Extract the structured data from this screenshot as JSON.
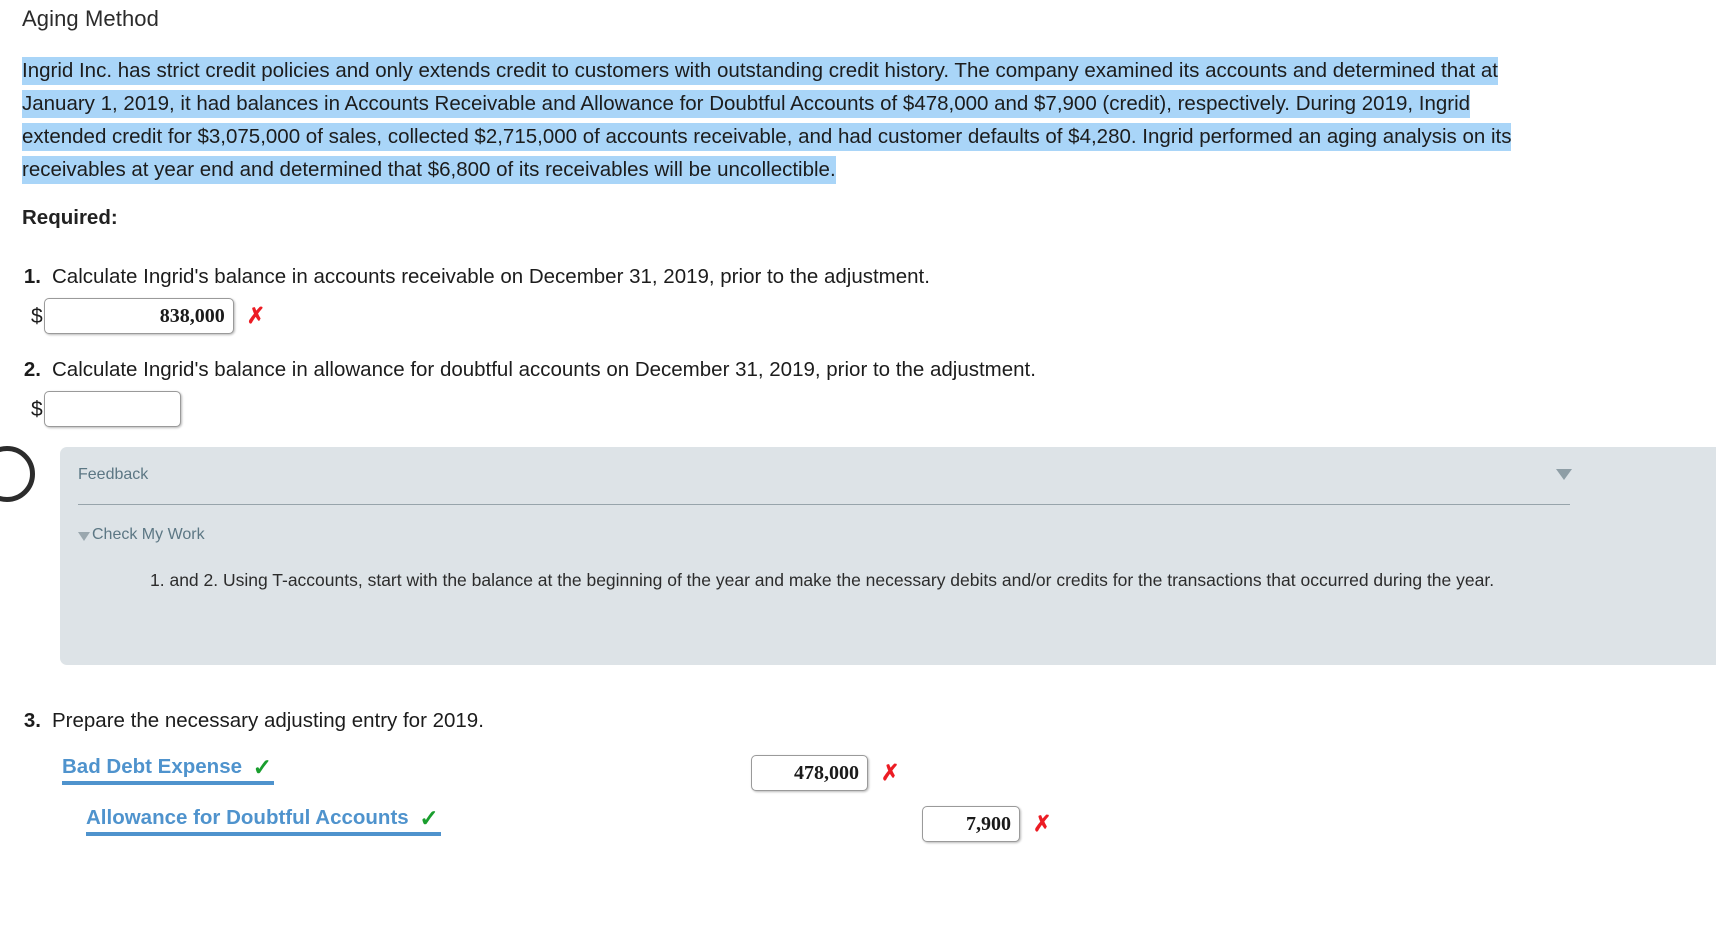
{
  "page": {
    "title": "Aging Method",
    "problem_text": "Ingrid Inc. has strict credit policies and only extends credit to customers with outstanding credit history. The company examined its accounts and determined that at January 1, 2019, it had balances in Accounts Receivable and Allowance for Doubtful Accounts of $478,000 and $7,900 (credit), respectively. During 2019, Ingrid extended credit for $3,075,000 of sales, collected $2,715,000 of accounts receivable, and had customer defaults of $4,280. Ingrid performed an aging analysis on its receivables at year end and determined that $6,800 of its receivables will be uncollectible.",
    "required_label": "Required:",
    "highlight_color": "#a9d5f8"
  },
  "requirements": [
    {
      "number": "1.",
      "text": "Calculate Ingrid's balance in accounts receivable on December 31, 2019, prior to the adjustment.",
      "currency_symbol": "$",
      "value": "838,000",
      "placeholder": "",
      "status": "incorrect",
      "status_glyph": "✗"
    },
    {
      "number": "2.",
      "text": "Calculate Ingrid's balance in allowance for doubtful accounts on December 31, 2019, prior to the adjustment.",
      "currency_symbol": "$",
      "value": "",
      "placeholder": "",
      "status": "none",
      "status_glyph": ""
    },
    {
      "number": "3.",
      "text": "Prepare the necessary adjusting entry for 2019."
    }
  ],
  "feedback": {
    "header": "Feedback",
    "collapse_glyph": "▼",
    "check_my_work_label": "Check My Work",
    "check_my_work_caret": "▼",
    "body": "1. and 2. Using T-accounts, start with the balance at the beginning of the year and make the necessary debits and/or credits for the transactions that occurred during the year.",
    "background_color": "#dde3e7",
    "label_color": "#5c7784"
  },
  "journal_entry": {
    "rows": [
      {
        "account": "Bad Debt Expense",
        "account_status": "correct",
        "account_glyph": "✓",
        "amount": "478,000",
        "amount_status": "incorrect",
        "amount_glyph": "✗"
      },
      {
        "account": "Allowance for Doubtful Accounts",
        "account_status": "correct",
        "account_glyph": "✓",
        "amount": "7,900",
        "amount_status": "incorrect",
        "amount_glyph": "✗"
      }
    ],
    "link_color": "#4f93cd",
    "correct_color": "#1a9e2e",
    "incorrect_color": "#ec1c24"
  }
}
